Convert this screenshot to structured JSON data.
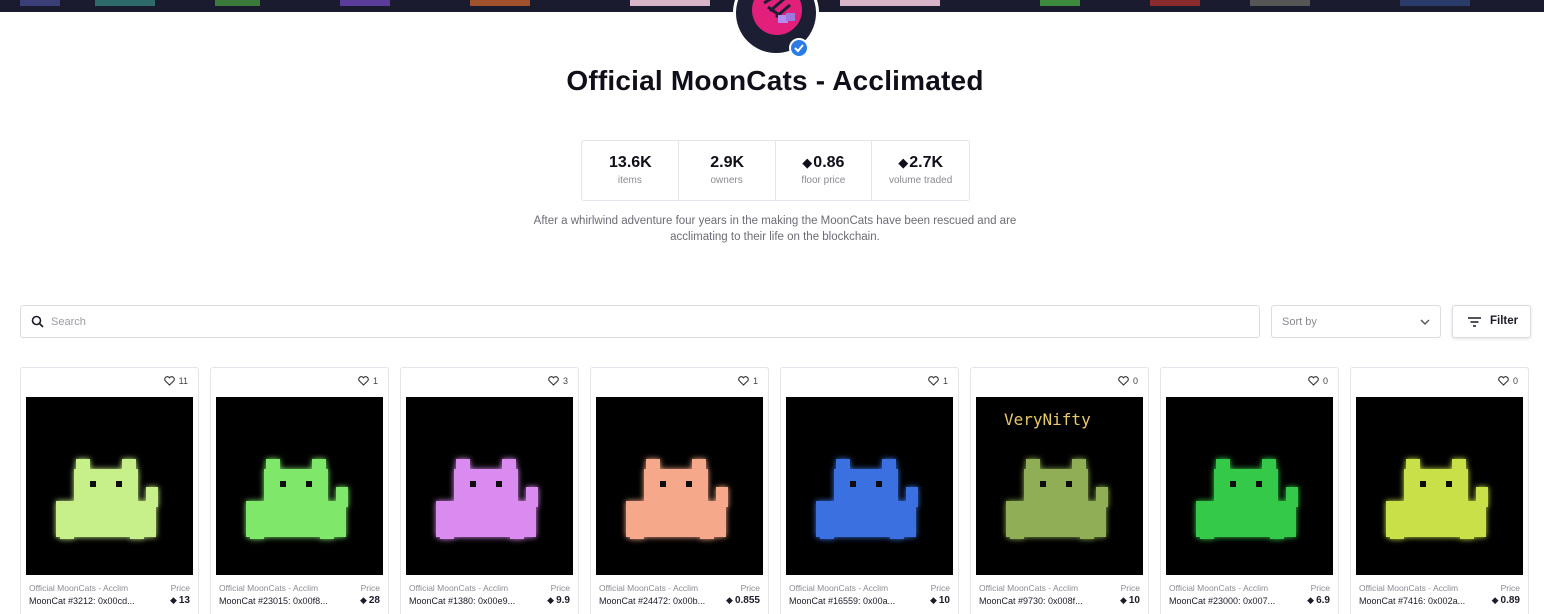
{
  "collection": {
    "title": "Official MoonCats - Acclimated",
    "verified_icon": "verified-badge-icon",
    "description": "After a whirlwind adventure four years in the making the MoonCats have been rescued and are acclimating to their life on the blockchain."
  },
  "stats": [
    {
      "value": "13.6K",
      "label": "items",
      "eth": ""
    },
    {
      "value": "2.9K",
      "label": "owners",
      "eth": ""
    },
    {
      "value": "0.86",
      "label": "floor price",
      "eth": "◆"
    },
    {
      "value": "2.7K",
      "label": "volume traded",
      "eth": "◆"
    }
  ],
  "search": {
    "placeholder": "Search",
    "icon": "search-icon"
  },
  "sort": {
    "label": "Sort by",
    "icon": "chevron-down-icon"
  },
  "filter": {
    "label": "Filter",
    "icon": "filter-icon"
  },
  "currency_symbol": "◆",
  "items": [
    {
      "likes": "11",
      "collection": "Official MoonCats - Acclim",
      "price_label": "Price",
      "name": "MoonCat #3212: 0x00cd...",
      "price": "13",
      "color": "#c8f08a"
    },
    {
      "likes": "1",
      "collection": "Official MoonCats - Acclim",
      "price_label": "Price",
      "name": "MoonCat #23015: 0x00f8...",
      "price": "28",
      "color": "#7fe86a"
    },
    {
      "likes": "3",
      "collection": "Official MoonCats - Acclim",
      "price_label": "Price",
      "name": "MoonCat #1380: 0x00e9...",
      "price": "9.9",
      "color": "#d98bf0"
    },
    {
      "likes": "1",
      "collection": "Official MoonCats - Acclim",
      "price_label": "Price",
      "name": "MoonCat #24472: 0x00b...",
      "price": "0.855",
      "color": "#f5a98a"
    },
    {
      "likes": "1",
      "collection": "Official MoonCats - Acclim",
      "price_label": "Price",
      "name": "MoonCat #16559: 0x00a...",
      "price": "10",
      "color": "#3b6fe0"
    },
    {
      "likes": "0",
      "collection": "Official MoonCats - Acclim",
      "price_label": "Price",
      "name": "MoonCat #9730: 0x008f...",
      "price": "10",
      "color": "#8fae54",
      "overlay": "VeryNifty"
    },
    {
      "likes": "0",
      "collection": "Official MoonCats - Acclim",
      "price_label": "Price",
      "name": "MoonCat #23000: 0x007...",
      "price": "6.9",
      "color": "#34c94a"
    },
    {
      "likes": "0",
      "collection": "Official MoonCats - Acclim",
      "price_label": "Price",
      "name": "MoonCat #7416: 0x002a...",
      "price": "0.89",
      "color": "#c9e04a"
    }
  ]
}
